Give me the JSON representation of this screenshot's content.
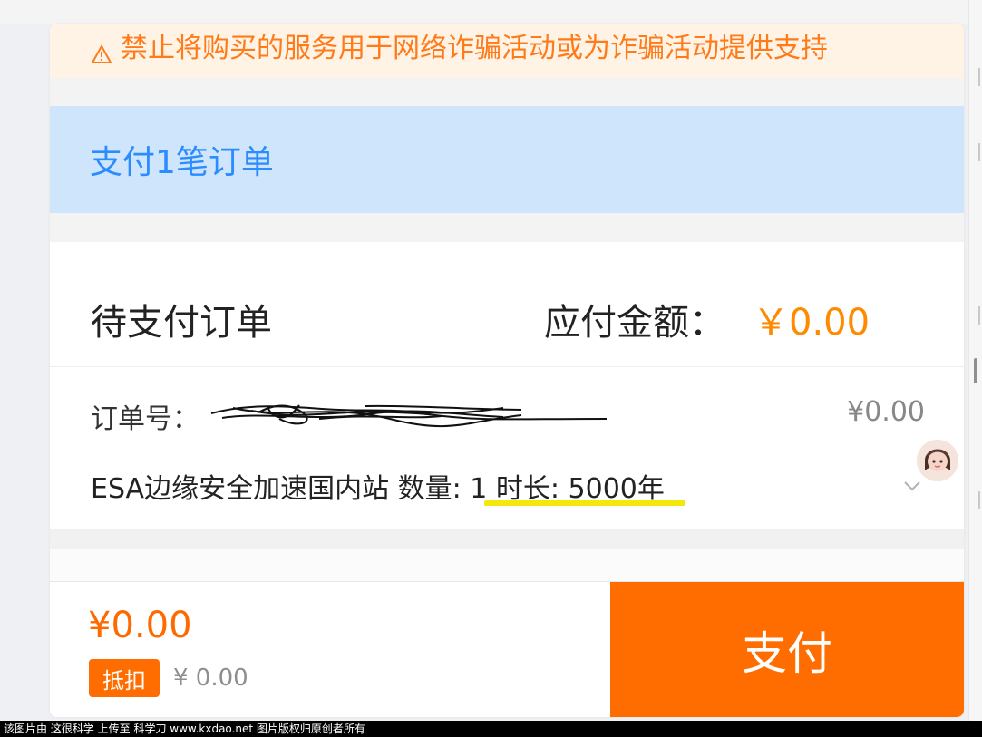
{
  "warning": {
    "text": "禁止将购买的服务用于网络诈骗活动或为诈骗活动提供支持",
    "icon": "warning-icon"
  },
  "payment": {
    "title": "支付1笔订单"
  },
  "order": {
    "title": "待支付订单",
    "amount_label": "应付金额：",
    "amount_value": "￥0.00",
    "number_label": "订单号：",
    "number_value": "",
    "price": "¥0.00",
    "detail": "ESA边缘安全加速国内站 数量: 1 时长: 5000年"
  },
  "footer": {
    "total": "¥0.00",
    "deduct_label": "抵扣",
    "deduct_value": "¥ 0.00",
    "pay_label": "支付"
  },
  "watermark": {
    "text": "该图片由 这很科学 上传至 科学刀 www.kxdao.net 图片版权归原创者所有"
  },
  "colors": {
    "warning_bg": "#fff3e6",
    "warning_text": "#ff7a18",
    "pay_bar_bg": "#cfe5fb",
    "pay_bar_text": "#2b8cff",
    "accent": "#ff6d00",
    "highlight": "#f4e70a"
  },
  "icons": {
    "warning": "warning-triangle-icon",
    "expand": "chevron-down-icon",
    "assistant": "assistant-avatar-icon"
  }
}
